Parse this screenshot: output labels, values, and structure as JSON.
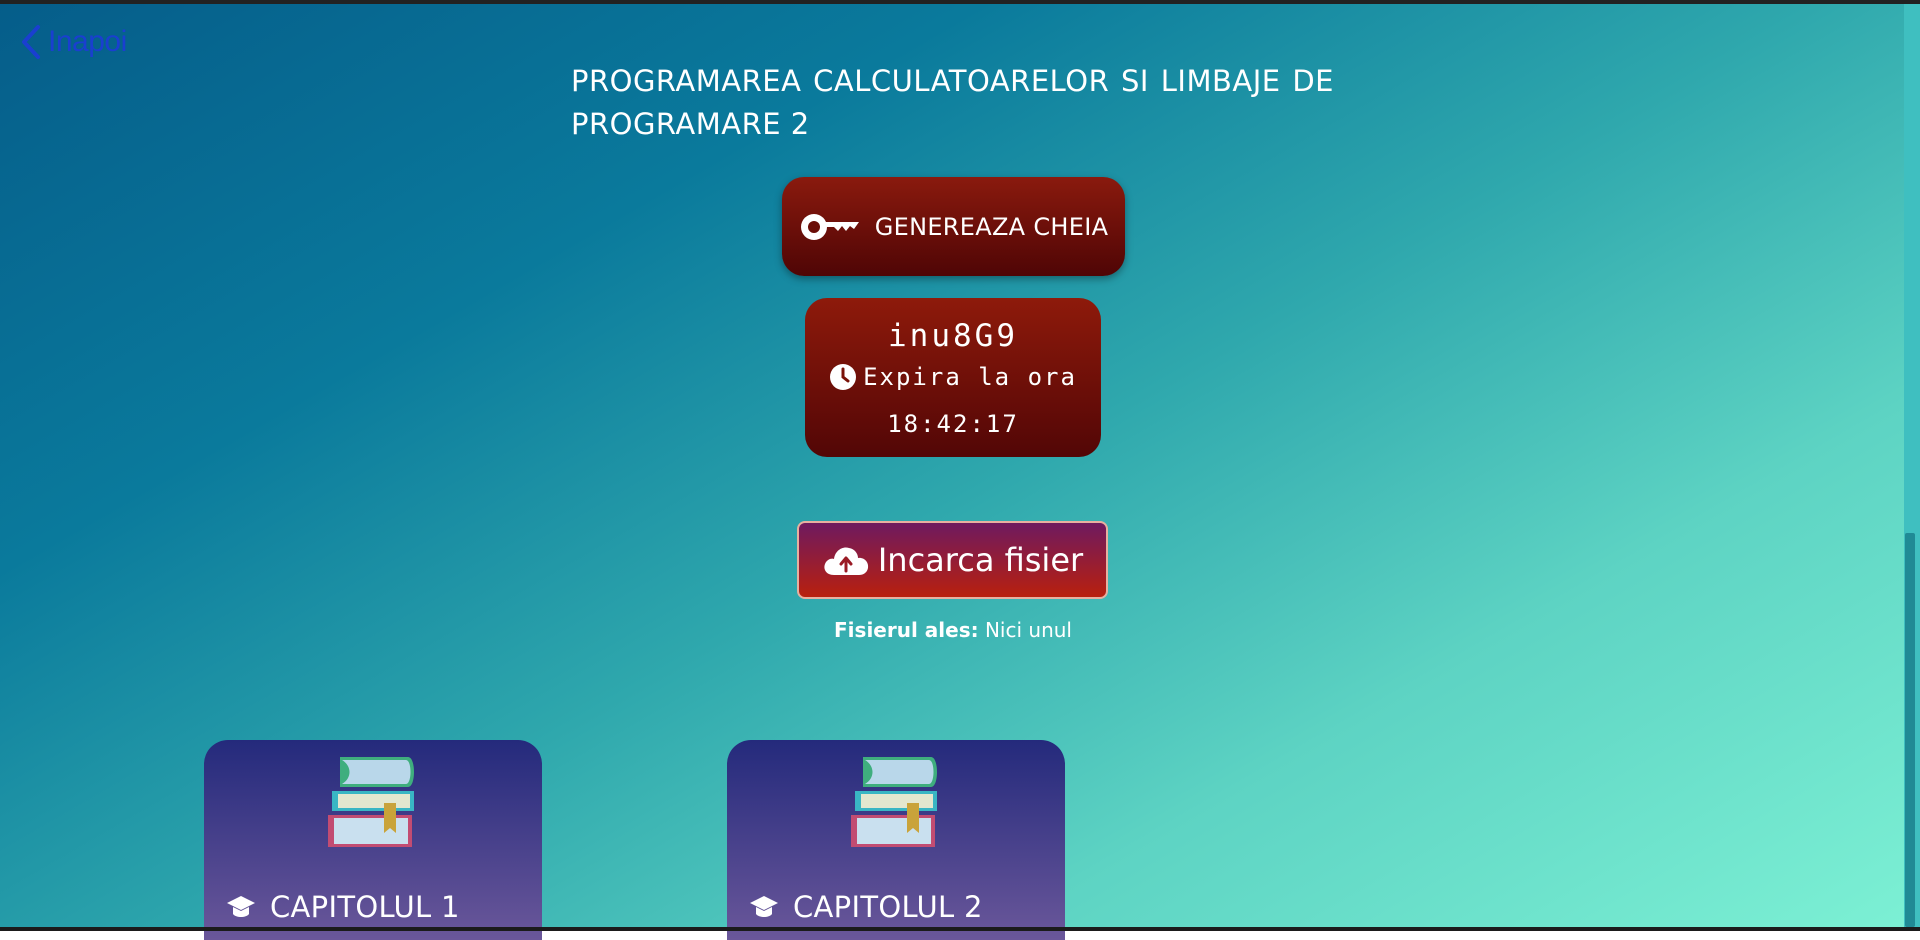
{
  "nav": {
    "back_label": "Inapoi"
  },
  "page": {
    "title": "PROGRAMAREA CALCULATOARELOR SI LIMBAJE DE PROGRAMARE 2"
  },
  "key": {
    "generate_label": "GENEREAZA CHEIA",
    "value": "inu8G9",
    "expires_label": "Expira la ora",
    "expires_time": "18:42:17"
  },
  "upload": {
    "button_label": "Incarca fisier",
    "chosen_label": "Fisierul ales:",
    "chosen_value": "Nici unul"
  },
  "chapters": [
    {
      "label": "CAPITOLUL 1"
    },
    {
      "label": "CAPITOLUL 2"
    }
  ],
  "icons": {
    "back": "chevron-left-icon",
    "key": "key-icon",
    "clock": "clock-icon",
    "upload": "cloud-upload-icon",
    "books": "books-stack-icon",
    "chapter": "graduation-cap-icon"
  },
  "colors": {
    "back_link": "#1a3fd0",
    "generate_button": "#7a1208",
    "upload_gradient_top": "#6e1a5f",
    "upload_gradient_bottom": "#b8200e",
    "card_top": "#242a7c",
    "card_bottom": "#6a579a"
  }
}
